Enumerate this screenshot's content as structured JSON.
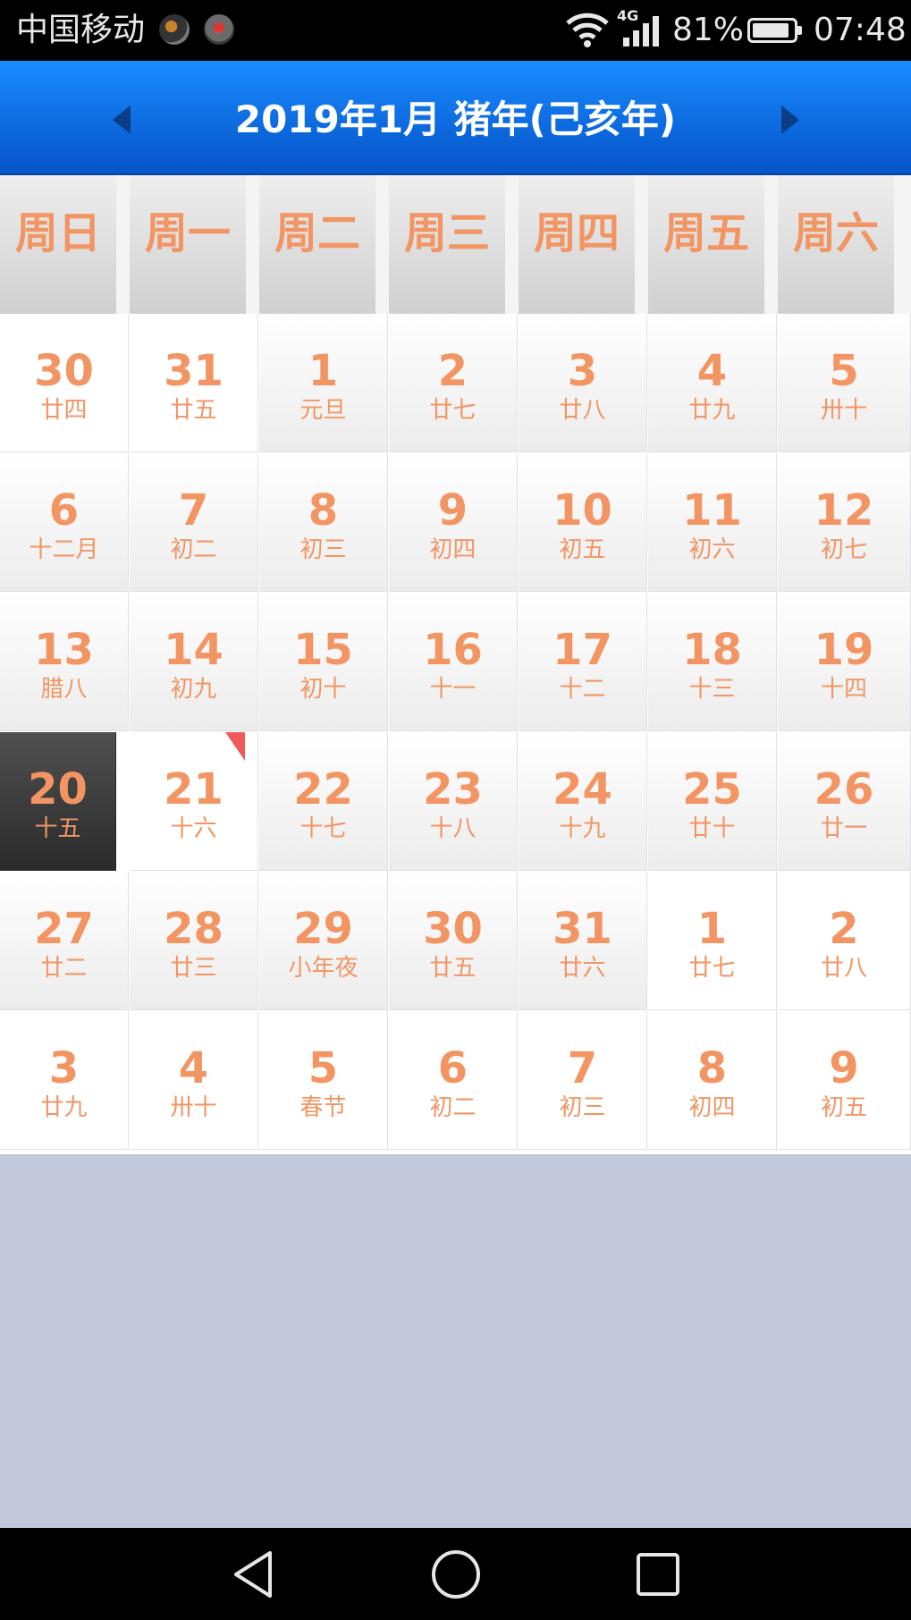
{
  "status_bar": {
    "carrier": "中国移动",
    "network": "4G",
    "battery": "81%",
    "time": "07:48"
  },
  "header": {
    "title": "2019年1月  猪年(己亥年)"
  },
  "weekdays": [
    "周日",
    "周一",
    "周二",
    "周三",
    "周四",
    "周五",
    "周六"
  ],
  "weeks": [
    [
      {
        "d": "30",
        "l": "廿四"
      },
      {
        "d": "31",
        "l": "廿五"
      },
      {
        "d": "1",
        "l": "元旦"
      },
      {
        "d": "2",
        "l": "廿七"
      },
      {
        "d": "3",
        "l": "廿八"
      },
      {
        "d": "4",
        "l": "廿九"
      },
      {
        "d": "5",
        "l": "卅十"
      }
    ],
    [
      {
        "d": "6",
        "l": "十二月"
      },
      {
        "d": "7",
        "l": "初二"
      },
      {
        "d": "8",
        "l": "初三"
      },
      {
        "d": "9",
        "l": "初四"
      },
      {
        "d": "10",
        "l": "初五"
      },
      {
        "d": "11",
        "l": "初六"
      },
      {
        "d": "12",
        "l": "初七"
      }
    ],
    [
      {
        "d": "13",
        "l": "腊八"
      },
      {
        "d": "14",
        "l": "初九"
      },
      {
        "d": "15",
        "l": "初十"
      },
      {
        "d": "16",
        "l": "十一"
      },
      {
        "d": "17",
        "l": "十二"
      },
      {
        "d": "18",
        "l": "十三"
      },
      {
        "d": "19",
        "l": "十四"
      }
    ],
    [
      {
        "d": "20",
        "l": "十五"
      },
      {
        "d": "21",
        "l": "十六"
      },
      {
        "d": "22",
        "l": "十七"
      },
      {
        "d": "23",
        "l": "十八"
      },
      {
        "d": "24",
        "l": "十九"
      },
      {
        "d": "25",
        "l": "廿十"
      },
      {
        "d": "26",
        "l": "廿一"
      }
    ],
    [
      {
        "d": "27",
        "l": "廿二"
      },
      {
        "d": "28",
        "l": "廿三"
      },
      {
        "d": "29",
        "l": "小年夜"
      },
      {
        "d": "30",
        "l": "廿五"
      },
      {
        "d": "31",
        "l": "廿六"
      },
      {
        "d": "1",
        "l": "廿七"
      },
      {
        "d": "2",
        "l": "廿八"
      }
    ],
    [
      {
        "d": "3",
        "l": "廿九"
      },
      {
        "d": "4",
        "l": "卅十"
      },
      {
        "d": "5",
        "l": "春节"
      },
      {
        "d": "6",
        "l": "初二"
      },
      {
        "d": "7",
        "l": "初三"
      },
      {
        "d": "8",
        "l": "初四"
      },
      {
        "d": "9",
        "l": "初五"
      }
    ]
  ],
  "selected_day": "20",
  "today_marker_day": "21",
  "colors": {
    "accent": "#f29563",
    "header_blue": "#0a63d8",
    "background": "#c2c9da"
  },
  "icons": {
    "prev": "caret-left-icon",
    "next": "caret-right-icon",
    "back": "triangle-back-icon",
    "home": "circle-home-icon",
    "recent": "square-recents-icon"
  }
}
